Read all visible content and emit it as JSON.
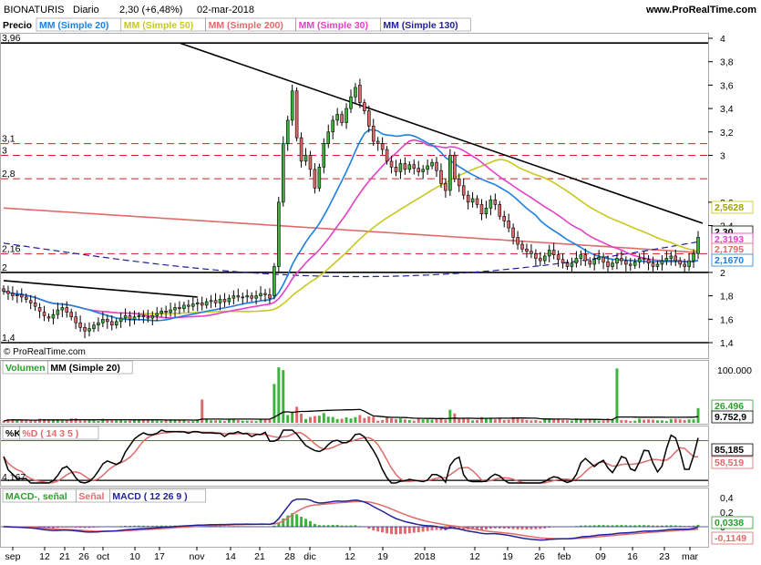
{
  "header": {
    "symbol": "BIONATURIS",
    "period": "Diario",
    "quote": "2,30 (+6,48%)",
    "date": "02-mar-2018",
    "provider": "www.ProRealTime.com",
    "copyright": "© ProRealTime.com"
  },
  "legend_price": {
    "price_label": "Precio",
    "items": [
      {
        "label": "MM (Simple 20)",
        "color": "#1e7fe0"
      },
      {
        "label": "MM (Simple 50)",
        "color": "#c8c81e"
      },
      {
        "label": "MM (Simple 200)",
        "color": "#e06a6a"
      },
      {
        "label": "MM (Simple 30)",
        "color": "#e640c8"
      },
      {
        "label": "MM (Simple 130)",
        "color": "#22229a"
      }
    ]
  },
  "price_axis": {
    "ticks": [
      "4",
      "3,8",
      "3,6",
      "3,4",
      "3,2",
      "3",
      "2,6",
      "2,4",
      "2",
      "1,8",
      "1,6",
      "1,4"
    ],
    "left_levels": [
      "3,96",
      "3,1",
      "3",
      "2,8",
      "2,16",
      "2",
      "1,4"
    ],
    "value_badges": [
      {
        "text": "2,5628",
        "color": "#c8c81e"
      },
      {
        "text": "2,30",
        "color": "#000000"
      },
      {
        "text": "2,3193",
        "color": "#e640c8"
      },
      {
        "text": "2,1795",
        "color": "#e06a6a"
      },
      {
        "text": "2,1670",
        "color": "#1e7fe0"
      }
    ]
  },
  "volume_panel": {
    "legend": [
      {
        "label": "Volumen",
        "color": "#28a028"
      },
      {
        "label": "MM (Simple 20)",
        "color": "#000000"
      }
    ],
    "ticks": [
      "100.000"
    ],
    "value_badges": [
      {
        "text": "26.496",
        "color": "#28a028"
      },
      {
        "text": "9.752,9",
        "color": "#000000"
      }
    ]
  },
  "stoch_panel": {
    "legend": [
      {
        "label": "%K",
        "color": "#000000"
      },
      {
        "label": "%D ( 14 3 5 )",
        "color": "#e06a6a"
      }
    ],
    "left_level": "4,167",
    "value_badges": [
      {
        "text": "85,185",
        "color": "#000000"
      },
      {
        "text": "58,519",
        "color": "#e06a6a"
      }
    ]
  },
  "macd_panel": {
    "legend": [
      {
        "label": "MACD-, señal",
        "color": "#28a028"
      },
      {
        "label": "Señal",
        "color": "#e06a6a"
      },
      {
        "label": "MACD ( 12 26 9 )",
        "color": "#22229a"
      }
    ],
    "ticks": [
      "0,4",
      "0,2",
      "0"
    ],
    "value_badges": [
      {
        "text": "0,0338",
        "color": "#28a028"
      },
      {
        "text": "-0,1149",
        "color": "#e06a6a"
      }
    ]
  },
  "x_axis": {
    "ticks": [
      "sep",
      "12",
      "21",
      "26",
      "oct",
      "10",
      "17",
      "nov",
      "14",
      "21",
      "28",
      "dic",
      "12",
      "19",
      "2018",
      "12",
      "19",
      "26",
      "feb",
      "09",
      "16",
      "23",
      "mar"
    ]
  },
  "chart_data": {
    "type": "candlestick",
    "title": "BIONATURIS Diario",
    "x_range": [
      "sep 2017",
      "02-mar-2018"
    ],
    "ylim": [
      1.4,
      4.0
    ],
    "levels": [
      3.96,
      3.1,
      3.0,
      2.8,
      2.16,
      2.0,
      1.4
    ],
    "trendlines": [
      {
        "from": [
          0,
          1.93
        ],
        "to": [
          43,
          1.79
        ]
      },
      {
        "from": [
          39,
          3.96
        ],
        "to": [
          155,
          2.42
        ]
      }
    ],
    "series": [
      {
        "name": "Precio",
        "close": [
          1.84,
          1.82,
          1.8,
          1.81,
          1.79,
          1.77,
          1.74,
          1.71,
          1.67,
          1.63,
          1.61,
          1.64,
          1.68,
          1.7,
          1.66,
          1.62,
          1.57,
          1.53,
          1.5,
          1.52,
          1.55,
          1.57,
          1.6,
          1.58,
          1.55,
          1.58,
          1.61,
          1.63,
          1.6,
          1.62,
          1.63,
          1.62,
          1.61,
          1.63,
          1.65,
          1.67,
          1.66,
          1.68,
          1.7,
          1.69,
          1.72,
          1.71,
          1.73,
          1.74,
          1.72,
          1.75,
          1.76,
          1.74,
          1.77,
          1.75,
          1.78,
          1.8,
          1.79,
          1.79,
          1.8,
          1.78,
          1.8,
          1.82,
          1.81,
          1.78,
          2.05,
          2.6,
          3.1,
          3.3,
          3.55,
          3.15,
          2.95,
          3.0,
          2.88,
          2.72,
          2.9,
          3.1,
          3.2,
          3.3,
          3.35,
          3.28,
          3.4,
          3.5,
          3.58,
          3.45,
          3.38,
          3.25,
          3.12,
          3.1,
          3.05,
          2.95,
          2.9,
          2.86,
          2.93,
          2.88,
          2.92,
          2.89,
          2.86,
          2.88,
          2.91,
          2.94,
          2.87,
          2.76,
          2.7,
          3.0,
          2.8,
          2.74,
          2.66,
          2.6,
          2.63,
          2.58,
          2.5,
          2.55,
          2.62,
          2.58,
          2.48,
          2.44,
          2.38,
          2.3,
          2.24,
          2.2,
          2.18,
          2.16,
          2.12,
          2.1,
          2.14,
          2.19,
          2.15,
          2.11,
          2.08,
          2.05,
          2.08,
          2.12,
          2.15,
          2.1,
          2.07,
          2.11,
          2.13,
          2.09,
          2.05,
          2.08,
          2.12,
          2.1,
          2.07,
          2.06,
          2.09,
          2.12,
          2.11,
          2.08,
          2.05,
          2.07,
          2.1,
          2.12,
          2.14,
          2.1,
          2.07,
          2.05,
          2.1,
          2.16,
          2.3
        ],
        "open": [
          1.86,
          1.84,
          1.82,
          1.8,
          1.81,
          1.79,
          1.76,
          1.74,
          1.7,
          1.66,
          1.62,
          1.61,
          1.64,
          1.68,
          1.7,
          1.66,
          1.62,
          1.57,
          1.53,
          1.5,
          1.52,
          1.55,
          1.57,
          1.6,
          1.58,
          1.55,
          1.58,
          1.61,
          1.63,
          1.6,
          1.62,
          1.63,
          1.62,
          1.61,
          1.63,
          1.65,
          1.67,
          1.66,
          1.68,
          1.7,
          1.69,
          1.72,
          1.71,
          1.73,
          1.74,
          1.72,
          1.75,
          1.76,
          1.74,
          1.77,
          1.75,
          1.78,
          1.8,
          1.79,
          1.79,
          1.8,
          1.78,
          1.8,
          1.82,
          1.81,
          1.8,
          2.05,
          2.6,
          3.1,
          3.3,
          3.55,
          3.15,
          2.95,
          3.0,
          2.88,
          2.72,
          2.9,
          3.1,
          3.2,
          3.3,
          3.35,
          3.28,
          3.4,
          3.5,
          3.6,
          3.45,
          3.38,
          3.25,
          3.12,
          3.1,
          3.05,
          2.95,
          2.9,
          2.86,
          2.93,
          2.88,
          2.92,
          2.89,
          2.86,
          2.88,
          2.91,
          2.94,
          2.87,
          2.76,
          2.7,
          3.0,
          2.8,
          2.74,
          2.66,
          2.6,
          2.63,
          2.58,
          2.5,
          2.55,
          2.62,
          2.58,
          2.48,
          2.44,
          2.38,
          2.3,
          2.24,
          2.2,
          2.18,
          2.16,
          2.12,
          2.1,
          2.14,
          2.19,
          2.15,
          2.11,
          2.08,
          2.05,
          2.08,
          2.12,
          2.15,
          2.1,
          2.07,
          2.11,
          2.13,
          2.09,
          2.05,
          2.08,
          2.12,
          2.1,
          2.07,
          2.06,
          2.09,
          2.12,
          2.11,
          2.08,
          2.05,
          2.07,
          2.1,
          2.12,
          2.14,
          2.1,
          2.07,
          2.05,
          2.1,
          2.16
        ]
      },
      {
        "name": "MM (Simple 20)"
      },
      {
        "name": "MM (Simple 30)"
      },
      {
        "name": "MM (Simple 50)"
      },
      {
        "name": "MM (Simple 130)"
      },
      {
        "name": "MM (Simple 200)"
      }
    ]
  }
}
